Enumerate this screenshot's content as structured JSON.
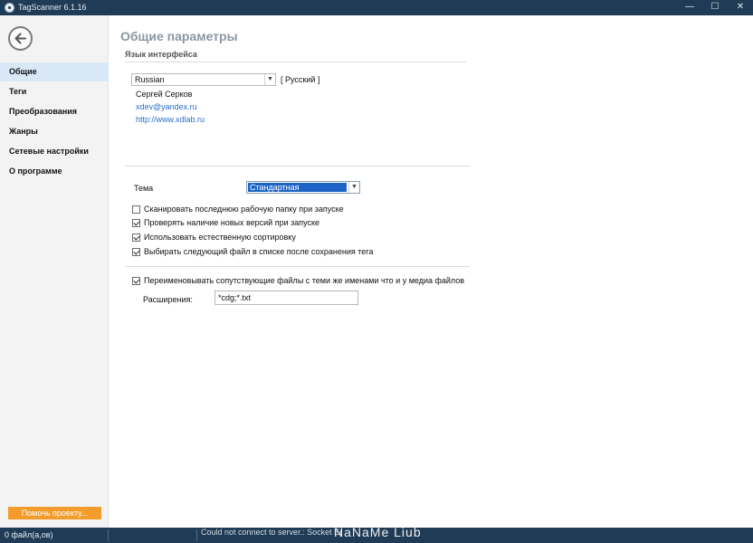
{
  "window": {
    "title": "TagScanner 6.1.16",
    "controls": {
      "minimize": "—",
      "maximize": "☐",
      "close": "✕"
    }
  },
  "sidebar": {
    "back_icon": "arrow-left-icon",
    "items": [
      {
        "label": "Общие",
        "active": true
      },
      {
        "label": "Теги",
        "active": false
      },
      {
        "label": "Преобразования",
        "active": false
      },
      {
        "label": "Жанры",
        "active": false
      },
      {
        "label": "Сетевые настройки",
        "active": false
      },
      {
        "label": "О программе",
        "active": false
      }
    ],
    "help_button": "Помочь проекту...",
    "active_color": "#d9e8f7",
    "help_color": "#f39c2b"
  },
  "main": {
    "title": "Общие параметры",
    "language_section": {
      "heading": "Язык интерфейса",
      "selected_language": "Russian",
      "native_name": "[ Русский ]",
      "author": "Сергей Серков",
      "email": "xdev@yandex.ru",
      "website": "http://www.xdlab.ru"
    },
    "theme": {
      "label": "Тема",
      "value": "Стандартная"
    },
    "options": [
      {
        "label": "Сканировать последнюю рабочую папку при запуске",
        "checked": false
      },
      {
        "label": "Проверять наличие новых версий при запуске",
        "checked": true
      },
      {
        "label": "Использовать естественную сортировку",
        "checked": true
      },
      {
        "label": "Выбирать следующий файл в списке после сохранения тега",
        "checked": true
      }
    ],
    "rename_related": {
      "label": "Переименовывать сопутствующие файлы с теми же именами что и у медиа файлов",
      "checked": true,
      "extensions_label": "Расширения:",
      "extensions_value": "*cdg;*.txt"
    }
  },
  "status_bar": {
    "files": "0 файл(а,ов)",
    "message": "Could not connect to server.: Socket Er",
    "watermark": "NaNaMe Liub"
  },
  "colors": {
    "titlebar": "#1f3b55",
    "link": "#2a6fc9",
    "heading": "#8a96a3",
    "selection": "#1e64c8"
  }
}
